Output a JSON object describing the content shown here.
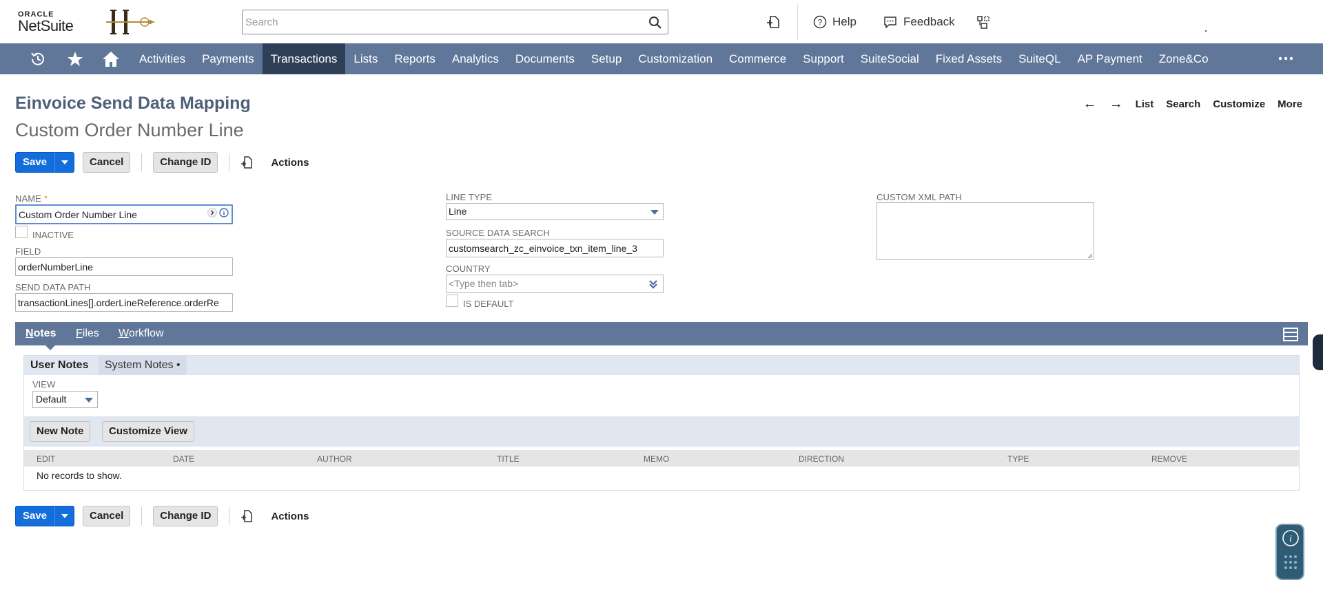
{
  "header": {
    "logo_oracle": "ORACLE",
    "logo_netsuite": "NetSuite",
    "search_placeholder": "Search",
    "help_label": "Help",
    "feedback_label": "Feedback"
  },
  "nav": {
    "items": [
      {
        "label": "Activities",
        "active": false
      },
      {
        "label": "Payments",
        "active": false
      },
      {
        "label": "Transactions",
        "active": true
      },
      {
        "label": "Lists",
        "active": false
      },
      {
        "label": "Reports",
        "active": false
      },
      {
        "label": "Analytics",
        "active": false
      },
      {
        "label": "Documents",
        "active": false
      },
      {
        "label": "Setup",
        "active": false
      },
      {
        "label": "Customization",
        "active": false
      },
      {
        "label": "Commerce",
        "active": false
      },
      {
        "label": "Support",
        "active": false
      },
      {
        "label": "SuiteSocial",
        "active": false
      },
      {
        "label": "Fixed Assets",
        "active": false
      },
      {
        "label": "SuiteQL",
        "active": false
      },
      {
        "label": "AP Payment",
        "active": false
      },
      {
        "label": "Zone&Co",
        "active": false
      }
    ]
  },
  "page": {
    "title": "Einvoice Send Data Mapping",
    "record_name": "Custom Order Number Line",
    "nav_links": {
      "list": "List",
      "search": "Search",
      "customize": "Customize",
      "more": "More"
    }
  },
  "buttons": {
    "save": "Save",
    "cancel": "Cancel",
    "change_id": "Change ID",
    "actions": "Actions"
  },
  "form": {
    "name_label": "NAME",
    "name_required": "*",
    "name_value": "Custom Order Number Line",
    "inactive_label": "INACTIVE",
    "field_label": "FIELD",
    "field_value": "orderNumberLine",
    "send_data_path_label": "SEND DATA PATH",
    "send_data_path_value": "transactionLines[].orderLineReference.orderRe",
    "line_type_label": "LINE TYPE",
    "line_type_value": "Line",
    "source_data_search_label": "SOURCE DATA SEARCH",
    "source_data_search_value": "customsearch_zc_einvoice_txn_item_line_3",
    "country_label": "COUNTRY",
    "country_placeholder": "<Type then tab>",
    "is_default_label": "IS DEFAULT",
    "custom_xml_path_label": "CUSTOM XML PATH",
    "custom_xml_path_value": ""
  },
  "subtabs": {
    "tabs": [
      {
        "label": "Notes",
        "first": "N",
        "rest": "otes",
        "active": true
      },
      {
        "label": "Files",
        "first": "F",
        "rest": "iles",
        "active": false
      },
      {
        "label": "Workflow",
        "first": "W",
        "rest": "orkflow",
        "active": false
      }
    ],
    "inner_tabs": {
      "user_notes": "User Notes",
      "system_notes": "System Notes •"
    },
    "view_label": "VIEW",
    "view_value": "Default",
    "new_note": "New Note",
    "customize_view": "Customize View",
    "columns": [
      "EDIT",
      "DATE",
      "AUTHOR",
      "TITLE",
      "MEMO",
      "DIRECTION",
      "TYPE",
      "REMOVE"
    ],
    "empty_message": "No records to show."
  },
  "colors": {
    "nav_bg": "#607799",
    "nav_active": "#2f3f57",
    "primary_button": "#136ddb",
    "title_color": "#4d5f79"
  }
}
